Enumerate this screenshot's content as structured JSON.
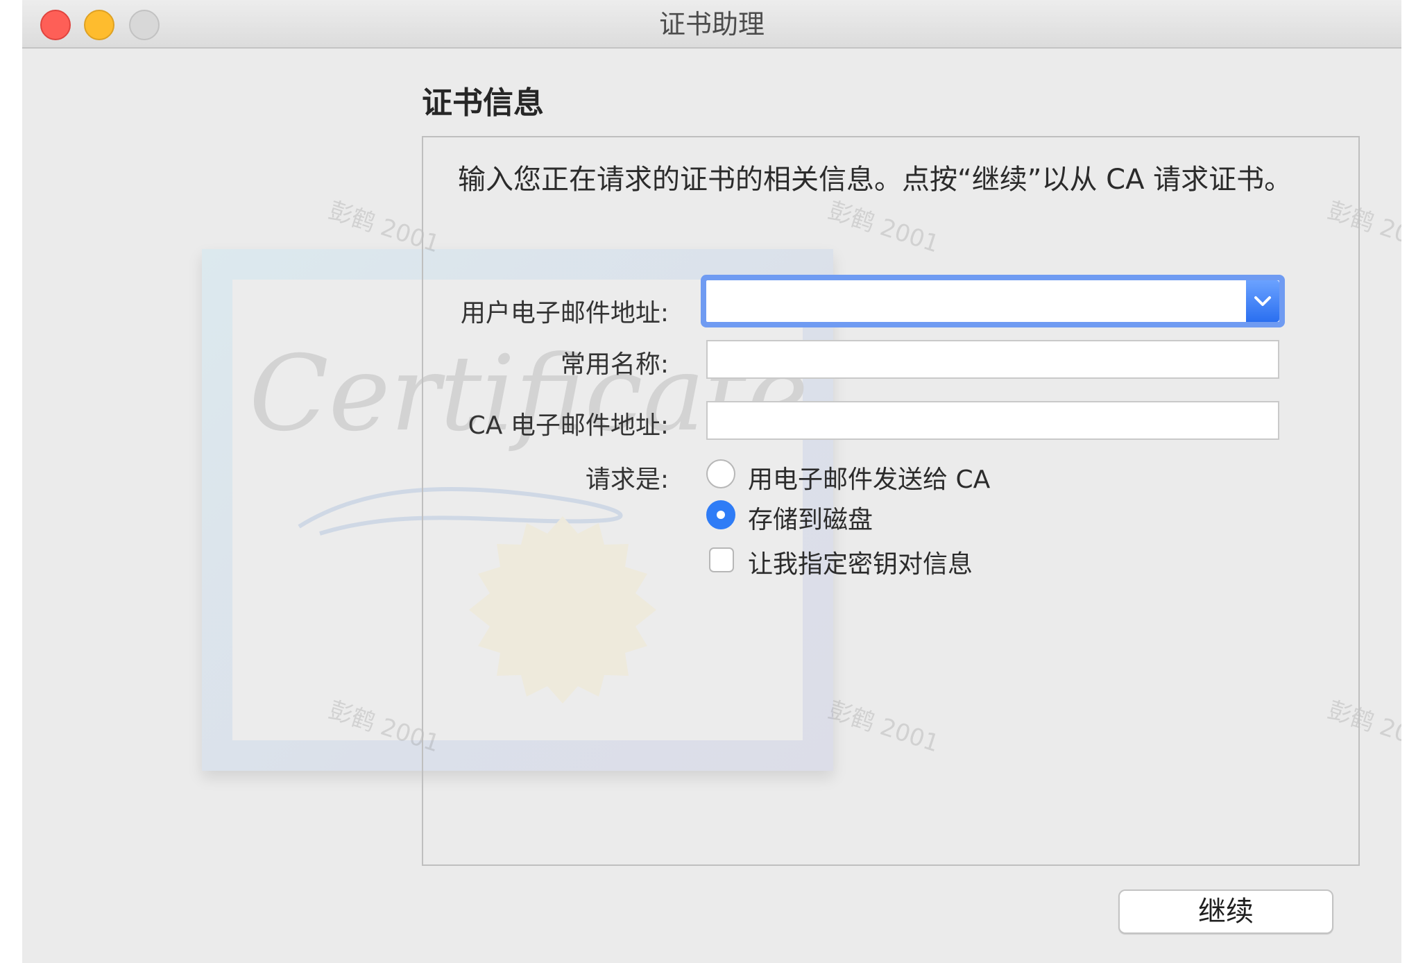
{
  "window": {
    "title": "证书助理"
  },
  "section": {
    "title": "证书信息"
  },
  "intro_text": "输入您正在请求的证书的相关信息。点按“继续”以从 CA 请求证书。",
  "fields": {
    "user_email": {
      "label": "用户电子邮件地址:",
      "value": ""
    },
    "common_name": {
      "label": "常用名称:",
      "value": ""
    },
    "ca_email": {
      "label": "CA 电子邮件地址:",
      "value": ""
    }
  },
  "request": {
    "label": "请求是:",
    "options": [
      {
        "label": "用电子邮件发送给 CA",
        "selected": false
      },
      {
        "label": "存储到磁盘",
        "selected": true
      }
    ],
    "checkbox": {
      "label": "让我指定密钥对信息",
      "checked": false
    }
  },
  "buttons": {
    "continue": "继续"
  },
  "illustration": {
    "script_text": "Certificate"
  },
  "watermark": "彭鹤 2001",
  "colors": {
    "accent": "#2f7cf6",
    "focus_ring": "#6f9bf2"
  }
}
